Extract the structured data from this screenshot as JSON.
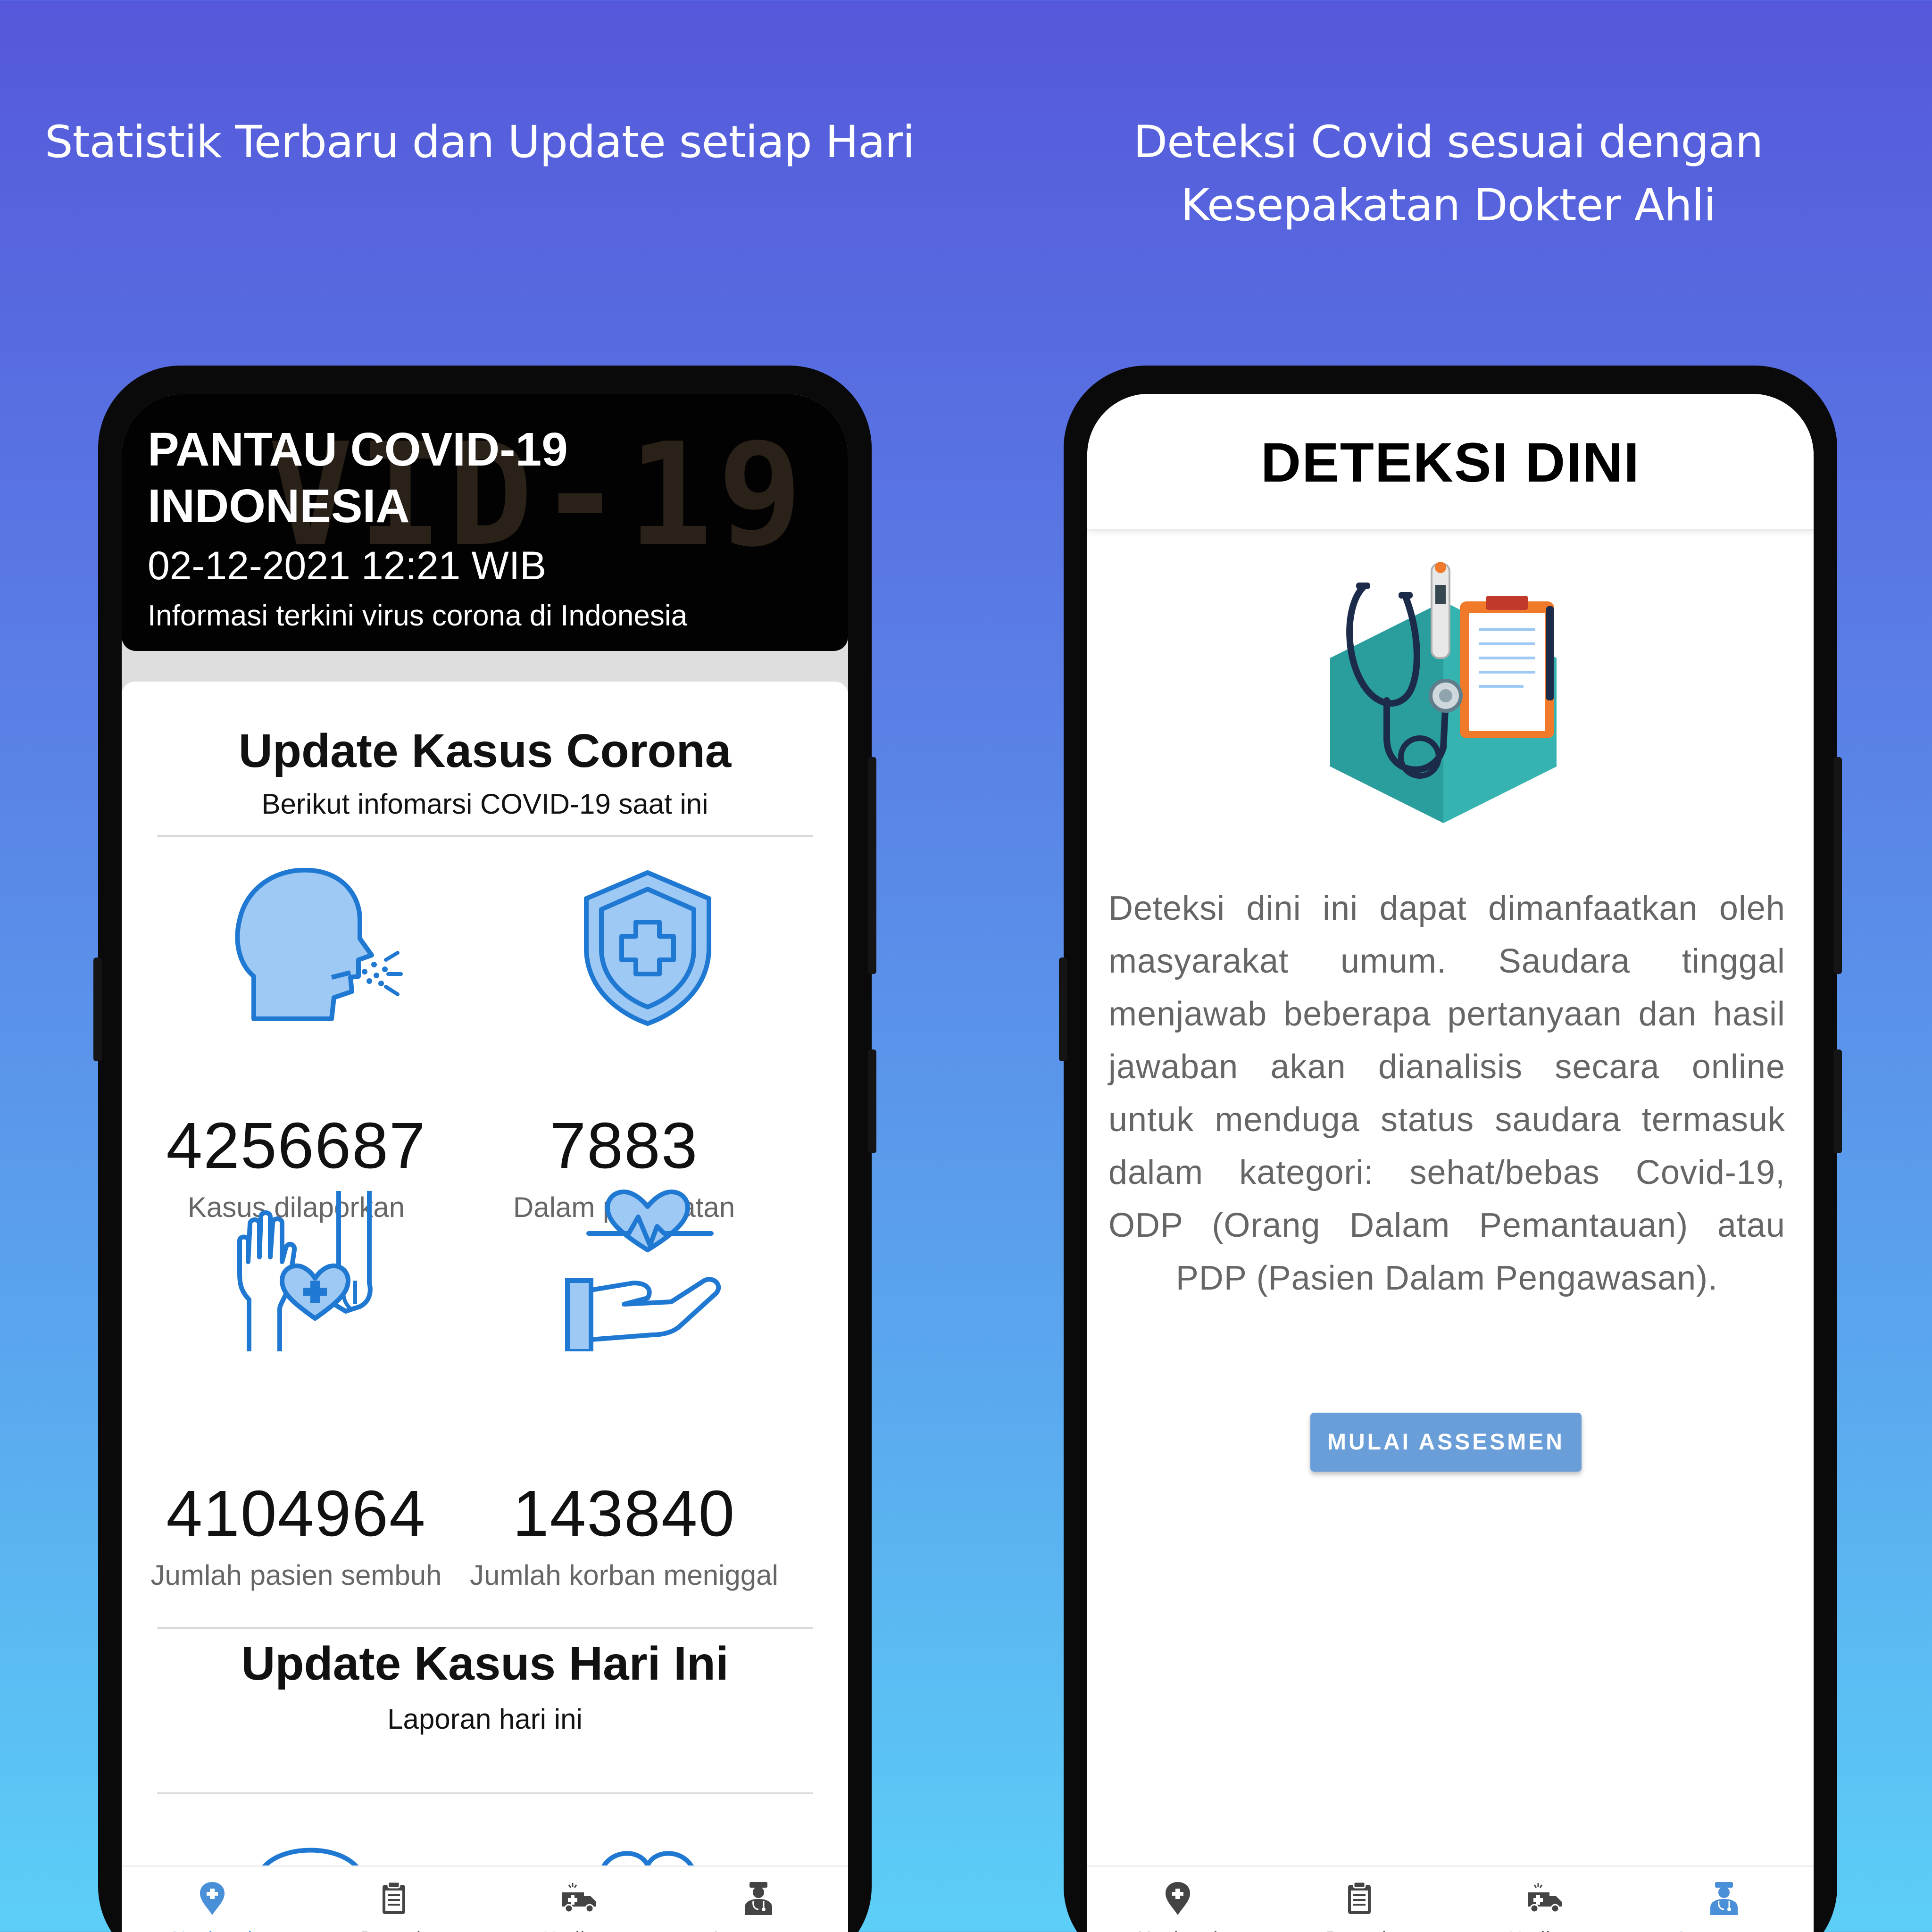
{
  "captions": {
    "left": "Statistik Terbaru dan Update setiap Hari",
    "right_line1": "Deteksi Covid sesuai dengan",
    "right_line2": "Kesepakatan Dokter Ahli"
  },
  "left_screen": {
    "header": {
      "title_line1": "PANTAU COVID-19",
      "title_line2": "INDONESIA",
      "datetime": "02-12-2021 12:21 WIB",
      "subtitle": "Informasi terkini virus corona di Indonesia",
      "background_text": "VID-19"
    },
    "section1": {
      "title": "Update Kasus Corona",
      "subtitle": "Berikut infomarsi COVID-19 saat ini"
    },
    "stats": [
      {
        "value": "4256687",
        "label": "Kasus dilaporkan",
        "icon": "cough-head-icon"
      },
      {
        "value": "7883",
        "label": "Dalam perawatan",
        "icon": "shield-cross-icon"
      },
      {
        "value": "4104964",
        "label": "Jumlah pasien sembuh",
        "icon": "hands-heart-icon"
      },
      {
        "value": "143840",
        "label": "Jumlah korban meniggal",
        "icon": "hand-heartbeat-icon"
      }
    ],
    "section2": {
      "title": "Update Kasus Hari Ini",
      "subtitle": "Laporan hari ini"
    }
  },
  "right_screen": {
    "title": "DETEKSI DINI",
    "body": "Deteksi dini ini dapat dimanfaatkan oleh masyarakat umum. Saudara tinggal menjawab beberapa pertanyaan dan hasil jawaban akan dianalisis secara online untuk menduga status saudara termasuk dalam kategori: sehat/bebas Covid-19, ODP (Orang Dalam Pemantauan) atau PDP (Pasien Dalam Pengawasan).",
    "button": "MULAI ASSESMEN"
  },
  "nav": {
    "items": [
      {
        "label": "Nasional",
        "icon": "map-pin-icon"
      },
      {
        "label": "Daerah",
        "icon": "clipboard-icon"
      },
      {
        "label": "Hotline",
        "icon": "ambulance-icon"
      },
      {
        "label": "Assesmen",
        "icon": "doctor-icon"
      }
    ],
    "left_active": "Nasional",
    "right_active": "Assesmen"
  },
  "colors": {
    "accent": "#4a90d9",
    "icon_fill": "#9ec9f5",
    "icon_stroke": "#1f78d1",
    "button": "#6a9ed8",
    "header_bg": "#020202"
  }
}
